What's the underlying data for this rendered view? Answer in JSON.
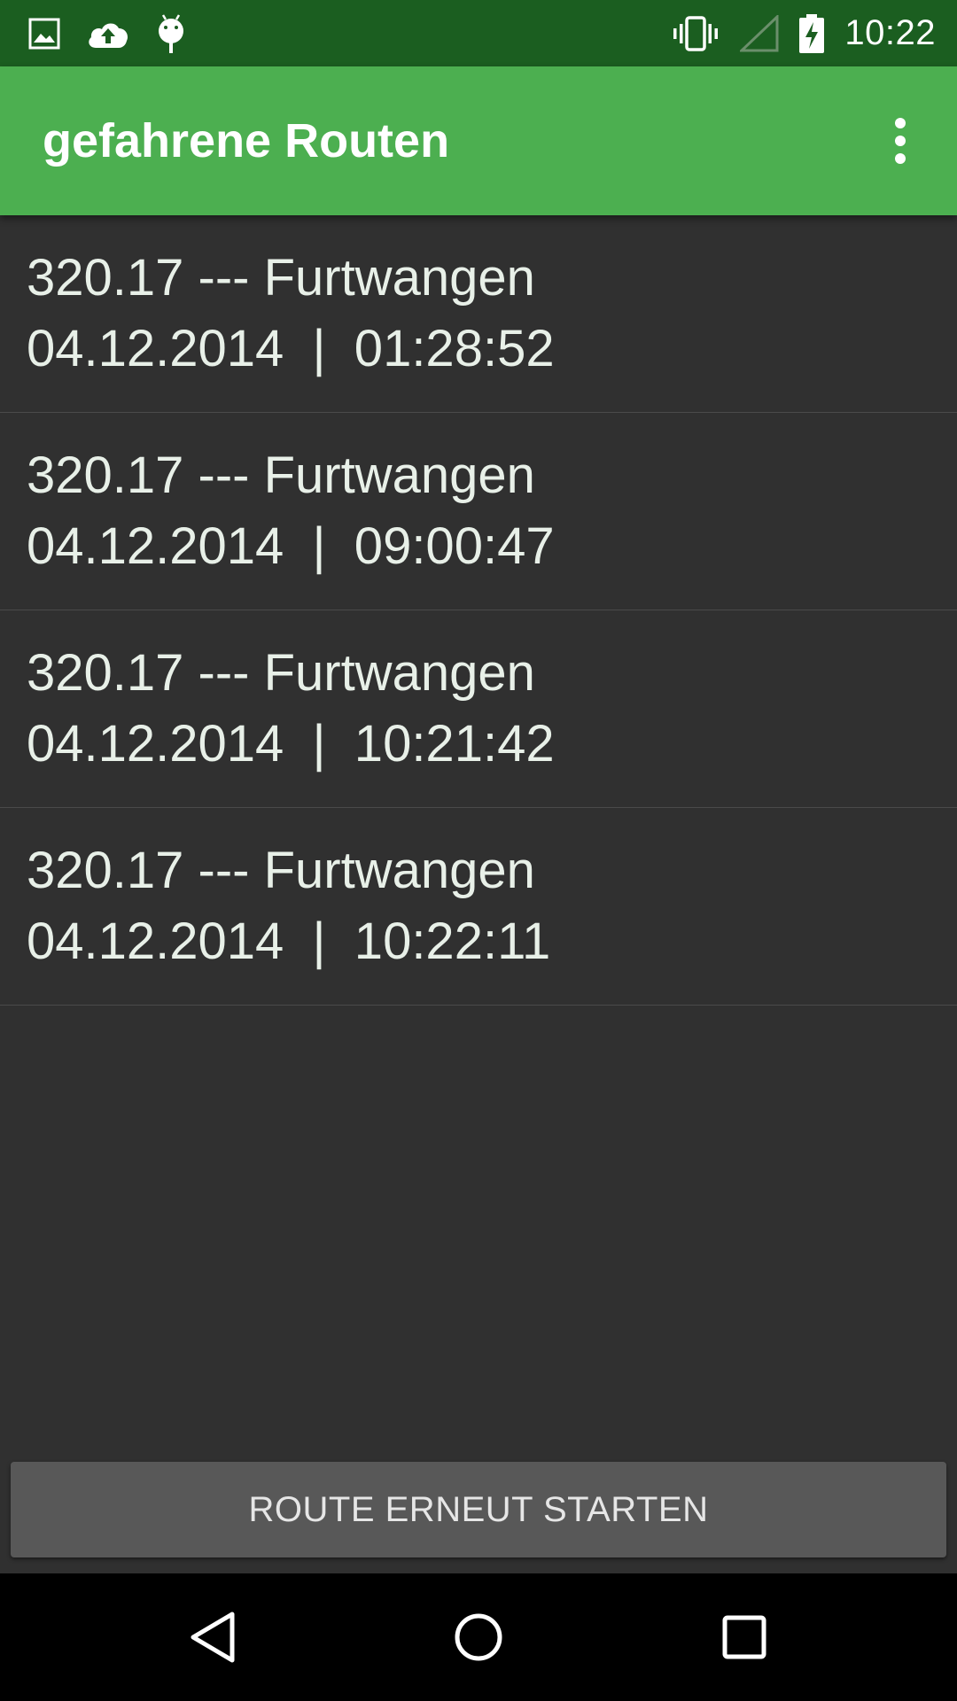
{
  "status_bar": {
    "time": "10:22",
    "left_icons": [
      "image-icon",
      "cloud-upload-icon",
      "android-debug-icon"
    ],
    "right_icons": [
      "vibrate-icon",
      "signal-icon",
      "battery-charging-icon"
    ]
  },
  "app_bar": {
    "title": "gefahrene Routen",
    "color": "#4caf50",
    "menu_icon": "more-vert-icon"
  },
  "routes": [
    {
      "name": "320.17 --- Furtwangen",
      "datetime": "04.12.2014  |  01:28:52"
    },
    {
      "name": "320.17 --- Furtwangen",
      "datetime": "04.12.2014  |  09:00:47"
    },
    {
      "name": "320.17 --- Furtwangen",
      "datetime": "04.12.2014  |  10:21:42"
    },
    {
      "name": "320.17 --- Furtwangen",
      "datetime": "04.12.2014  |  10:22:11"
    }
  ],
  "actions": {
    "restart_label": "ROUTE ERNEUT STARTEN"
  },
  "nav_bar": {
    "buttons": [
      "back-icon",
      "home-icon",
      "recents-icon"
    ]
  },
  "colors": {
    "status_bar": "#1b5e20",
    "background": "#303030",
    "button": "#585858"
  }
}
